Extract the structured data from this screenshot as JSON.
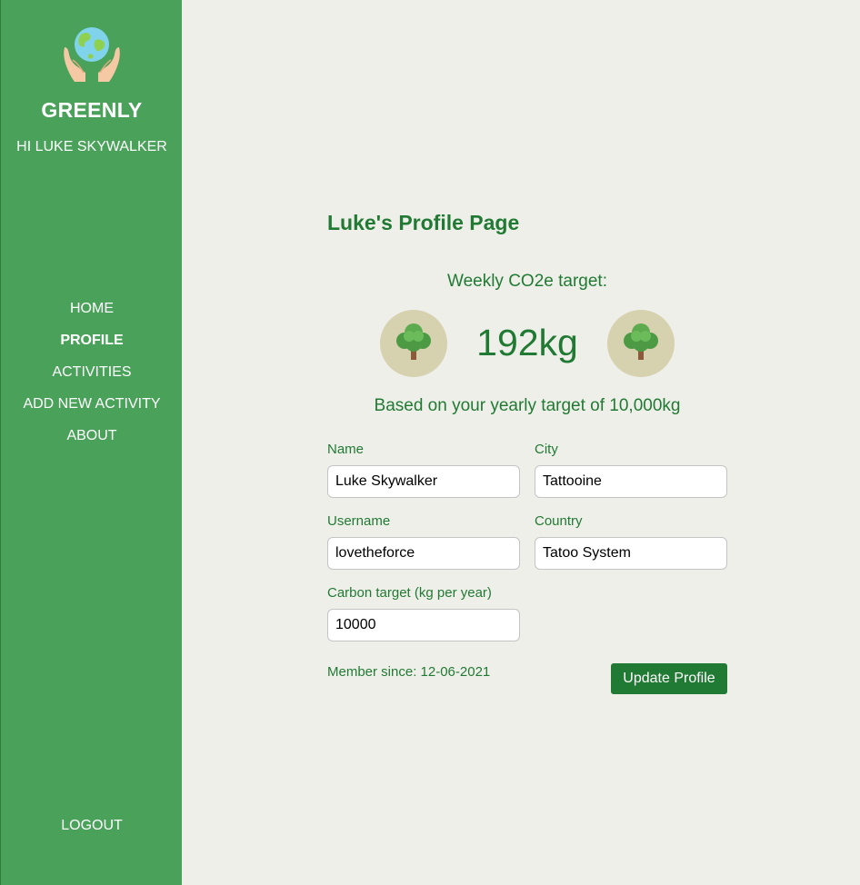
{
  "sidebar": {
    "logo_icon": "earth-in-hands-icon",
    "brand": "GREENLY",
    "greeting": "HI LUKE SKYWALKER",
    "nav": [
      {
        "label": "HOME",
        "active": false
      },
      {
        "label": "PROFILE",
        "active": true
      },
      {
        "label": "ACTIVITIES",
        "active": false
      },
      {
        "label": "ADD NEW ACTIVITY",
        "active": false
      },
      {
        "label": "ABOUT",
        "active": false
      }
    ],
    "logout": "LOGOUT"
  },
  "profile": {
    "title": "Luke's Profile Page",
    "weekly_target_label": "Weekly CO2e target:",
    "weekly_target_value": "192kg",
    "tree_icon": "tree-icon",
    "yearly_note": "Based on your yearly target of 10,000kg",
    "fields": {
      "name": {
        "label": "Name",
        "value": "Luke Skywalker"
      },
      "city": {
        "label": "City",
        "value": "Tattooine"
      },
      "username": {
        "label": "Username",
        "value": "lovetheforce"
      },
      "country": {
        "label": "Country",
        "value": "Tatoo System"
      },
      "carbon_target": {
        "label": "Carbon target (kg per year)",
        "value": "10000"
      }
    },
    "member_since": "Member since: 12-06-2021",
    "update_button": "Update Profile"
  },
  "colors": {
    "sidebar_bg": "#49a15a",
    "page_bg": "#efefea",
    "accent_green": "#217a33",
    "tree_badge_bg": "#d6d1ae"
  }
}
